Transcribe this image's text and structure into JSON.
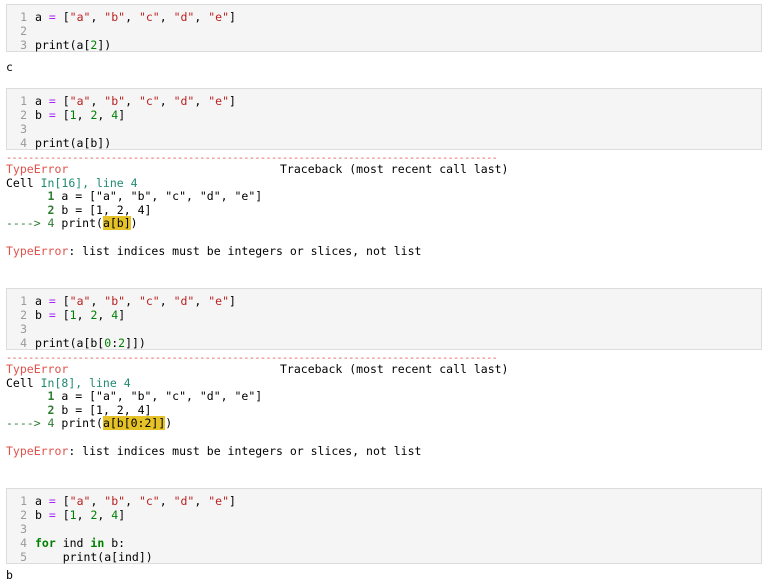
{
  "cells": [
    {
      "lines": [
        {
          "n": "1",
          "tokens": [
            [
              "t",
              "a "
            ],
            [
              "op",
              "="
            ],
            [
              "t",
              " ["
            ],
            [
              "str",
              "\"a\""
            ],
            [
              "t",
              ", "
            ],
            [
              "str",
              "\"b\""
            ],
            [
              "t",
              ", "
            ],
            [
              "str",
              "\"c\""
            ],
            [
              "t",
              ", "
            ],
            [
              "str",
              "\"d\""
            ],
            [
              "t",
              ", "
            ],
            [
              "str",
              "\"e\""
            ],
            [
              "t",
              "]"
            ]
          ]
        },
        {
          "n": "2",
          "tokens": []
        },
        {
          "n": "3",
          "tokens": [
            [
              "t",
              "print(a["
            ],
            [
              "num",
              "2"
            ],
            [
              "t",
              "])"
            ]
          ]
        }
      ],
      "output": "c"
    },
    {
      "lines": [
        {
          "n": "1",
          "tokens": [
            [
              "t",
              "a "
            ],
            [
              "op",
              "="
            ],
            [
              "t",
              " ["
            ],
            [
              "str",
              "\"a\""
            ],
            [
              "t",
              ", "
            ],
            [
              "str",
              "\"b\""
            ],
            [
              "t",
              ", "
            ],
            [
              "str",
              "\"c\""
            ],
            [
              "t",
              ", "
            ],
            [
              "str",
              "\"d\""
            ],
            [
              "t",
              ", "
            ],
            [
              "str",
              "\"e\""
            ],
            [
              "t",
              "]"
            ]
          ]
        },
        {
          "n": "2",
          "tokens": [
            [
              "t",
              "b "
            ],
            [
              "op",
              "="
            ],
            [
              "t",
              " ["
            ],
            [
              "num",
              "1"
            ],
            [
              "t",
              ", "
            ],
            [
              "num",
              "2"
            ],
            [
              "t",
              ", "
            ],
            [
              "num",
              "4"
            ],
            [
              "t",
              "]"
            ]
          ]
        },
        {
          "n": "3",
          "tokens": []
        },
        {
          "n": "4",
          "tokens": [
            [
              "t",
              "print(a[b])"
            ]
          ]
        }
      ],
      "error": {
        "dashes": "-----------------------------------------------------------------------------------------",
        "name": "TypeError",
        "traceback_label": "Traceback (most recent call last)",
        "cell_prefix": "Cell ",
        "cell_ref": "In[16], line 4",
        "tb_lines": [
          {
            "n": "1",
            "text": " a = [\"a\", \"b\", \"c\", \"d\", \"e\"]"
          },
          {
            "n": "2",
            "text": " b = [1, 2, 4]"
          }
        ],
        "arrow": "----> 4",
        "arrow_pre": " print(",
        "arrow_hl": "a[b]",
        "arrow_post": ")",
        "message": ": list indices must be integers or slices, not list"
      }
    },
    {
      "lines": [
        {
          "n": "1",
          "tokens": [
            [
              "t",
              "a "
            ],
            [
              "op",
              "="
            ],
            [
              "t",
              " ["
            ],
            [
              "str",
              "\"a\""
            ],
            [
              "t",
              ", "
            ],
            [
              "str",
              "\"b\""
            ],
            [
              "t",
              ", "
            ],
            [
              "str",
              "\"c\""
            ],
            [
              "t",
              ", "
            ],
            [
              "str",
              "\"d\""
            ],
            [
              "t",
              ", "
            ],
            [
              "str",
              "\"e\""
            ],
            [
              "t",
              "]"
            ]
          ]
        },
        {
          "n": "2",
          "tokens": [
            [
              "t",
              "b "
            ],
            [
              "op",
              "="
            ],
            [
              "t",
              " ["
            ],
            [
              "num",
              "1"
            ],
            [
              "t",
              ", "
            ],
            [
              "num",
              "2"
            ],
            [
              "t",
              ", "
            ],
            [
              "num",
              "4"
            ],
            [
              "t",
              "]"
            ]
          ]
        },
        {
          "n": "3",
          "tokens": []
        },
        {
          "n": "4",
          "tokens": [
            [
              "t",
              "print(a[b["
            ],
            [
              "num",
              "0"
            ],
            [
              "t",
              ":"
            ],
            [
              "num",
              "2"
            ],
            [
              "t",
              "]])"
            ]
          ]
        }
      ],
      "error": {
        "dashes": "-----------------------------------------------------------------------------------------",
        "name": "TypeError",
        "traceback_label": "Traceback (most recent call last)",
        "cell_prefix": "Cell ",
        "cell_ref": "In[8], line 4",
        "tb_lines": [
          {
            "n": "1",
            "text": " a = [\"a\", \"b\", \"c\", \"d\", \"e\"]"
          },
          {
            "n": "2",
            "text": " b = [1, 2, 4]"
          }
        ],
        "arrow": "----> 4",
        "arrow_pre": " print(",
        "arrow_hl": "a[b[0:2]]",
        "arrow_post": ")",
        "message": ": list indices must be integers or slices, not list"
      }
    },
    {
      "lines": [
        {
          "n": "1",
          "tokens": [
            [
              "t",
              "a "
            ],
            [
              "op",
              "="
            ],
            [
              "t",
              " ["
            ],
            [
              "str",
              "\"a\""
            ],
            [
              "t",
              ", "
            ],
            [
              "str",
              "\"b\""
            ],
            [
              "t",
              ", "
            ],
            [
              "str",
              "\"c\""
            ],
            [
              "t",
              ", "
            ],
            [
              "str",
              "\"d\""
            ],
            [
              "t",
              ", "
            ],
            [
              "str",
              "\"e\""
            ],
            [
              "t",
              "]"
            ]
          ]
        },
        {
          "n": "2",
          "tokens": [
            [
              "t",
              "b "
            ],
            [
              "op",
              "="
            ],
            [
              "t",
              " ["
            ],
            [
              "num",
              "1"
            ],
            [
              "t",
              ", "
            ],
            [
              "num",
              "2"
            ],
            [
              "t",
              ", "
            ],
            [
              "num",
              "4"
            ],
            [
              "t",
              "]"
            ]
          ]
        },
        {
          "n": "3",
          "tokens": []
        },
        {
          "n": "4",
          "tokens": [
            [
              "kw",
              "for"
            ],
            [
              "t",
              " ind "
            ],
            [
              "kw",
              "in"
            ],
            [
              "t",
              " b:"
            ]
          ]
        },
        {
          "n": "5",
          "tokens": [
            [
              "t",
              "    print(a[ind])"
            ]
          ]
        }
      ],
      "output": "b"
    }
  ]
}
